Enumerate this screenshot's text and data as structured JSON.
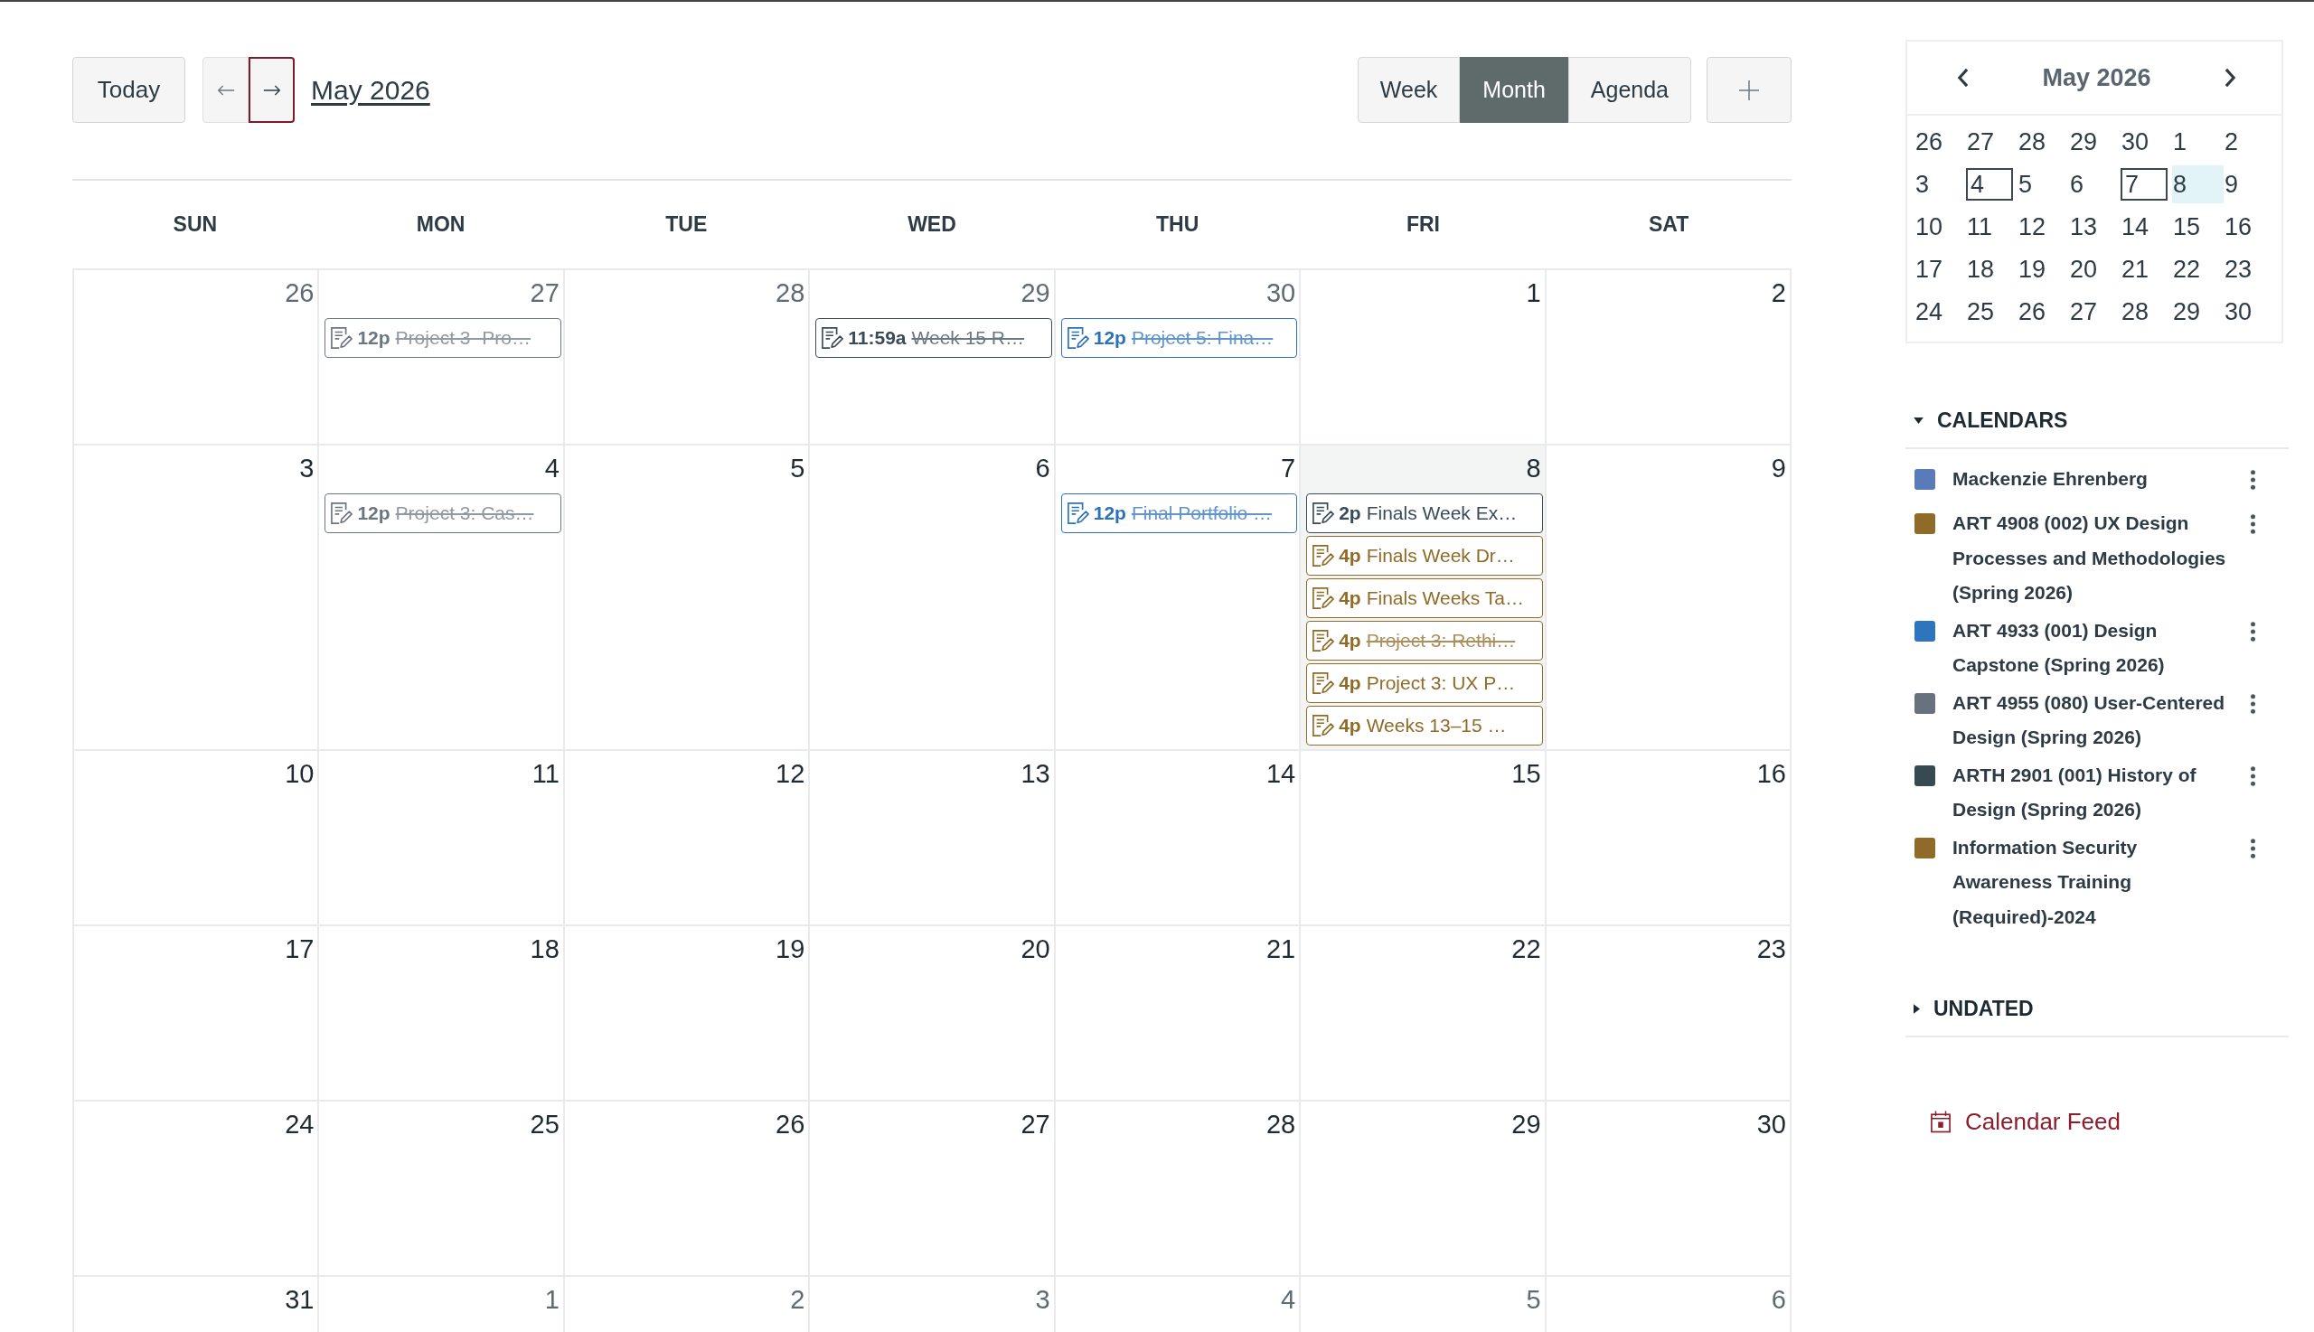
{
  "toolbar": {
    "today_label": "Today",
    "nav_buttons": [
      {
        "kind": "prev",
        "focused": false
      },
      {
        "kind": "next",
        "focused": true
      }
    ],
    "title": "May 2026",
    "views": [
      {
        "label": "Week",
        "selected": false
      },
      {
        "label": "Month",
        "selected": true
      },
      {
        "label": "Agenda",
        "selected": false
      }
    ]
  },
  "weekdays": [
    "SUN",
    "MON",
    "TUE",
    "WED",
    "THU",
    "FRI",
    "SAT"
  ],
  "weeks": [
    {
      "days": [
        {
          "date": "26",
          "other_month": true,
          "today": false
        },
        {
          "date": "27",
          "other_month": true,
          "today": false,
          "events": [
            {
              "time": "12p",
              "title": "Project 3- Pro…",
              "color": "#6b7780",
              "completed": true
            }
          ]
        },
        {
          "date": "28",
          "other_month": true,
          "today": false
        },
        {
          "date": "29",
          "other_month": true,
          "today": false,
          "events": [
            {
              "time": "11:59a",
              "title": "Week 15 R…",
              "color": "#394b58",
              "completed": true
            }
          ]
        },
        {
          "date": "30",
          "other_month": true,
          "today": false,
          "events": [
            {
              "time": "12p",
              "title": "Project 5: Fina…",
              "color": "#2d72b8",
              "completed": true
            }
          ]
        },
        {
          "date": "1",
          "other_month": false,
          "today": false
        },
        {
          "date": "2",
          "other_month": false,
          "today": false
        }
      ]
    },
    {
      "days": [
        {
          "date": "3",
          "other_month": false,
          "today": false
        },
        {
          "date": "4",
          "other_month": false,
          "today": false,
          "events": [
            {
              "time": "12p",
              "title": "Project 3: Cas…",
              "color": "#6b7780",
              "completed": true
            }
          ]
        },
        {
          "date": "5",
          "other_month": false,
          "today": false
        },
        {
          "date": "6",
          "other_month": false,
          "today": false
        },
        {
          "date": "7",
          "other_month": false,
          "today": false,
          "events": [
            {
              "time": "12p",
              "title": "Final Portfolio …",
              "color": "#2d72b8",
              "completed": true
            }
          ]
        },
        {
          "date": "8",
          "other_month": false,
          "today": true,
          "events": [
            {
              "time": "2p",
              "title": "Finals Week Ex…",
              "color": "#394b58",
              "completed": false
            },
            {
              "time": "4p",
              "title": "Finals Week Dr…",
              "color": "#8f6b27",
              "completed": false
            },
            {
              "time": "4p",
              "title": "Finals Weeks Ta…",
              "color": "#8f6b27",
              "completed": false
            },
            {
              "time": "4p",
              "title": "Project 3: Rethi…",
              "color": "#8f6b27",
              "completed": true
            },
            {
              "time": "4p",
              "title": "Project 3: UX P…",
              "color": "#8f6b27",
              "completed": false
            },
            {
              "time": "4p",
              "title": "Weeks 13–15 …",
              "color": "#8f6b27",
              "completed": false
            }
          ]
        },
        {
          "date": "9",
          "other_month": false,
          "today": false
        }
      ]
    },
    {
      "days": [
        {
          "date": "10",
          "other_month": false,
          "today": false
        },
        {
          "date": "11",
          "other_month": false,
          "today": false
        },
        {
          "date": "12",
          "other_month": false,
          "today": false
        },
        {
          "date": "13",
          "other_month": false,
          "today": false
        },
        {
          "date": "14",
          "other_month": false,
          "today": false
        },
        {
          "date": "15",
          "other_month": false,
          "today": false
        },
        {
          "date": "16",
          "other_month": false,
          "today": false
        }
      ]
    },
    {
      "days": [
        {
          "date": "17",
          "other_month": false,
          "today": false
        },
        {
          "date": "18",
          "other_month": false,
          "today": false
        },
        {
          "date": "19",
          "other_month": false,
          "today": false
        },
        {
          "date": "20",
          "other_month": false,
          "today": false
        },
        {
          "date": "21",
          "other_month": false,
          "today": false
        },
        {
          "date": "22",
          "other_month": false,
          "today": false
        },
        {
          "date": "23",
          "other_month": false,
          "today": false
        }
      ]
    },
    {
      "days": [
        {
          "date": "24",
          "other_month": false,
          "today": false
        },
        {
          "date": "25",
          "other_month": false,
          "today": false
        },
        {
          "date": "26",
          "other_month": false,
          "today": false
        },
        {
          "date": "27",
          "other_month": false,
          "today": false
        },
        {
          "date": "28",
          "other_month": false,
          "today": false
        },
        {
          "date": "29",
          "other_month": false,
          "today": false
        },
        {
          "date": "30",
          "other_month": false,
          "today": false
        }
      ]
    },
    {
      "days": [
        {
          "date": "31",
          "other_month": false,
          "today": false
        },
        {
          "date": "1",
          "other_month": true,
          "today": false
        },
        {
          "date": "2",
          "other_month": true,
          "today": false
        },
        {
          "date": "3",
          "other_month": true,
          "today": false
        },
        {
          "date": "4",
          "other_month": true,
          "today": false
        },
        {
          "date": "5",
          "other_month": true,
          "today": false
        },
        {
          "date": "6",
          "other_month": true,
          "today": false
        }
      ]
    }
  ],
  "mini_calendar": {
    "title": "May 2026",
    "weeks": [
      {
        "days": [
          {
            "date": "26",
            "boxed": false,
            "today": false
          },
          {
            "date": "27",
            "boxed": false,
            "today": false
          },
          {
            "date": "28",
            "boxed": false,
            "today": false
          },
          {
            "date": "29",
            "boxed": false,
            "today": false
          },
          {
            "date": "30",
            "boxed": false,
            "today": false
          },
          {
            "date": "1",
            "boxed": false,
            "today": false
          },
          {
            "date": "2",
            "boxed": false,
            "today": false
          }
        ]
      },
      {
        "days": [
          {
            "date": "3",
            "boxed": false,
            "today": false
          },
          {
            "date": "4",
            "boxed": true,
            "today": false
          },
          {
            "date": "5",
            "boxed": false,
            "today": false
          },
          {
            "date": "6",
            "boxed": false,
            "today": false
          },
          {
            "date": "7",
            "boxed": true,
            "today": false
          },
          {
            "date": "8",
            "boxed": false,
            "today": true
          },
          {
            "date": "9",
            "boxed": false,
            "today": false
          }
        ]
      },
      {
        "days": [
          {
            "date": "10",
            "boxed": false,
            "today": false
          },
          {
            "date": "11",
            "boxed": false,
            "today": false
          },
          {
            "date": "12",
            "boxed": false,
            "today": false
          },
          {
            "date": "13",
            "boxed": false,
            "today": false
          },
          {
            "date": "14",
            "boxed": false,
            "today": false
          },
          {
            "date": "15",
            "boxed": false,
            "today": false
          },
          {
            "date": "16",
            "boxed": false,
            "today": false
          }
        ]
      },
      {
        "days": [
          {
            "date": "17",
            "boxed": false,
            "today": false
          },
          {
            "date": "18",
            "boxed": false,
            "today": false
          },
          {
            "date": "19",
            "boxed": false,
            "today": false
          },
          {
            "date": "20",
            "boxed": false,
            "today": false
          },
          {
            "date": "21",
            "boxed": false,
            "today": false
          },
          {
            "date": "22",
            "boxed": false,
            "today": false
          },
          {
            "date": "23",
            "boxed": false,
            "today": false
          }
        ]
      },
      {
        "days": [
          {
            "date": "24",
            "boxed": false,
            "today": false
          },
          {
            "date": "25",
            "boxed": false,
            "today": false
          },
          {
            "date": "26",
            "boxed": false,
            "today": false
          },
          {
            "date": "27",
            "boxed": false,
            "today": false
          },
          {
            "date": "28",
            "boxed": false,
            "today": false
          },
          {
            "date": "29",
            "boxed": false,
            "today": false
          },
          {
            "date": "30",
            "boxed": false,
            "today": false
          }
        ]
      }
    ]
  },
  "calendars": {
    "title": "CALENDARS",
    "expanded": true,
    "items": [
      {
        "name": "Mackenzie Ehrenberg",
        "color": "#5a7bb9"
      },
      {
        "name": "ART 4908 (002) UX Design Processes and Methodologies (Spring 2026)",
        "color": "#8f6b27"
      },
      {
        "name": "ART 4933 (001) Design Capstone (Spring 2026)",
        "color": "#2f75bd"
      },
      {
        "name": "ART 4955 (080) User-Centered Design (Spring 2026)",
        "color": "#68717e"
      },
      {
        "name": "ARTH 2901 (001) History of Design (Spring 2026)",
        "color": "#374a52"
      },
      {
        "name": "Information Security Awareness Training (Required)-2024",
        "color": "#8f6b27"
      }
    ]
  },
  "undated": {
    "title": "UNDATED",
    "expanded": false
  },
  "feed_link": "Calendar Feed"
}
